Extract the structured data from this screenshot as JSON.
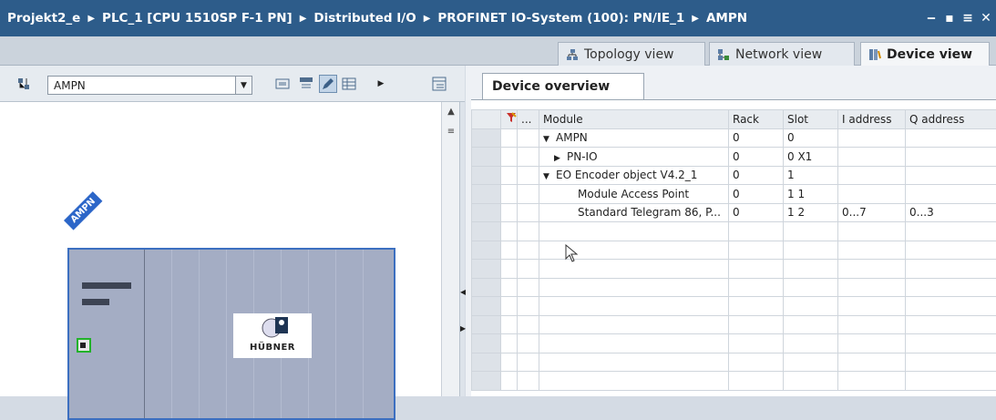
{
  "breadcrumb": [
    "Projekt2_e",
    "PLC_1 [CPU 1510SP F-1 PN]",
    "Distributed I/O",
    "PROFINET IO-System (100): PN/IE_1",
    "AMPN"
  ],
  "views": {
    "topology": "Topology view",
    "network": "Network view",
    "device": "Device view"
  },
  "toolbar": {
    "device_select": "AMPN"
  },
  "device": {
    "label": "AMPN",
    "logo_text": "HÜBNER"
  },
  "overview": {
    "tab": "Device overview",
    "columns": [
      "",
      "...",
      "Module",
      "Rack",
      "Slot",
      "I address",
      "Q address"
    ],
    "rows": [
      {
        "expander": "▼",
        "indent": 0,
        "module": "AMPN",
        "rack": "0",
        "slot": "0",
        "i": "",
        "q": ""
      },
      {
        "expander": "▶",
        "indent": 1,
        "module": "PN-IO",
        "rack": "0",
        "slot": "0 X1",
        "i": "",
        "q": ""
      },
      {
        "expander": "▼",
        "indent": 0,
        "module": "EO Encoder object V4.2_1",
        "rack": "0",
        "slot": "1",
        "i": "",
        "q": ""
      },
      {
        "expander": "",
        "indent": 2,
        "module": "Module Access Point",
        "rack": "0",
        "slot": "1 1",
        "i": "",
        "q": ""
      },
      {
        "expander": "",
        "indent": 2,
        "module": "Standard Telegram 86, P...",
        "rack": "0",
        "slot": "1 2",
        "i": "0...7",
        "q": "0...3"
      }
    ]
  }
}
